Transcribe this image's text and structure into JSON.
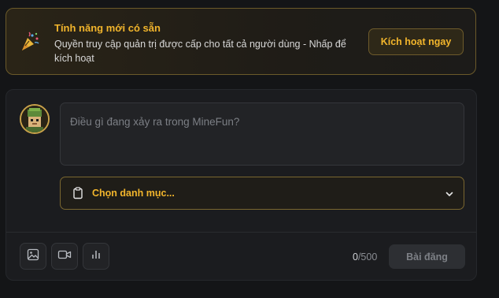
{
  "banner": {
    "title": "Tính năng mới có sẵn",
    "description": "Quyền truy cập quản trị được cấp cho tất cả người dùng - Nhấp để kích hoạt",
    "button_label": "Kích hoạt ngay",
    "icon": "party-popper-icon"
  },
  "composer": {
    "placeholder": "Điều gì đang xảy ra trong MineFun?",
    "category_label": "Chọn danh mục...",
    "toolbar": {
      "icons": [
        "image-icon",
        "video-icon",
        "poll-icon"
      ]
    },
    "char_count": "0",
    "char_limit": "/500",
    "post_label": "Bài đăng"
  },
  "colors": {
    "accent": "#f2b52c",
    "background": "#141517",
    "panel": "#1b1c1f"
  }
}
